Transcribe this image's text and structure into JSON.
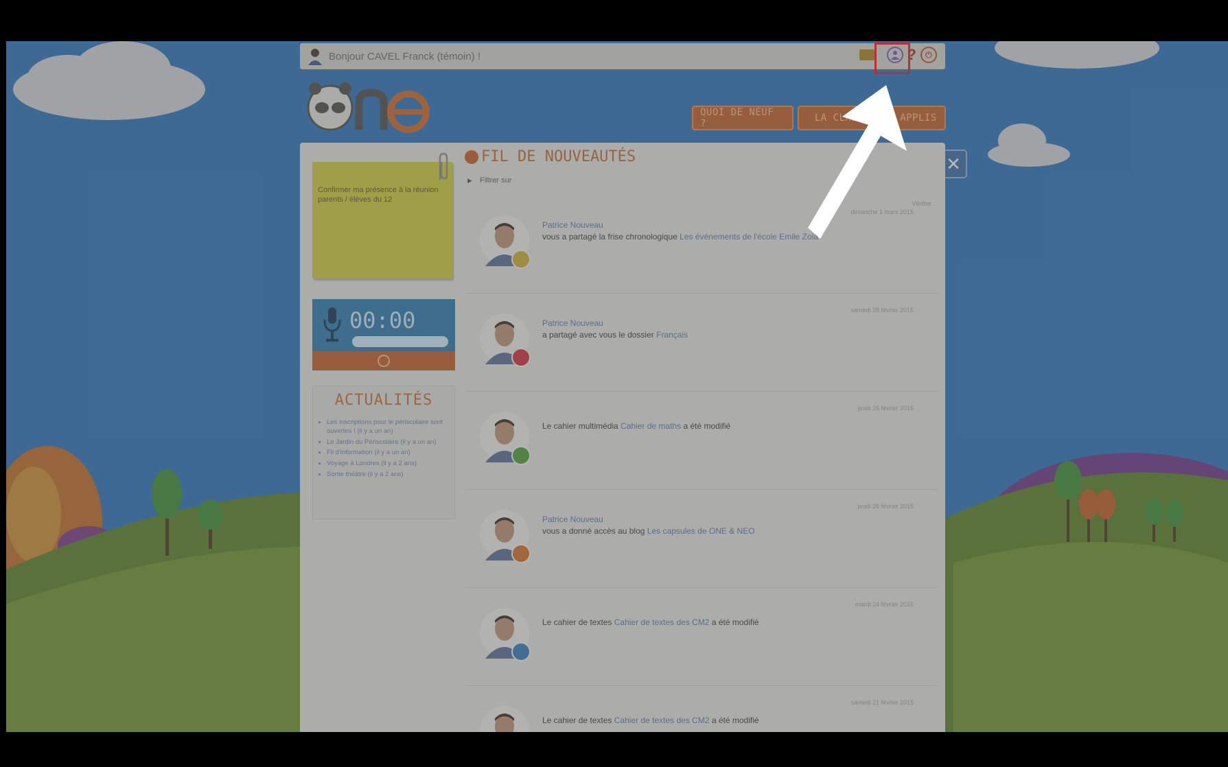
{
  "header": {
    "greeting": "Bonjour CAVEL Franck (témoin) !"
  },
  "nav": {
    "buttons": [
      "QUOI DE NEUF ?",
      "LA CLASSE",
      "APPLIS"
    ]
  },
  "postit": {
    "text": "Confirmer ma présence à la réunion parents / élèves du 12"
  },
  "recorder": {
    "time": "00:00"
  },
  "news": {
    "title": "ACTUALITÉS",
    "items": [
      "Les inscriptions pour le périscolaire sont ouvertes ! (il y a un an)",
      "Le Jardin du Périscolaire (il y a un an)",
      "Fil d'information (il y a un an)",
      "Voyage à Londres (il y a 2 ans)",
      "Sortie théâtre (il y a 2 ans)"
    ]
  },
  "feed": {
    "title": "FIL DE NOUVEAUTÉS",
    "filter": "Filtrer sur",
    "hint": "Vérifier",
    "items": [
      {
        "date": "dimanche 1 mars 2015",
        "who": "Patrice Nouveau",
        "pre": "vous a partagé la frise chronologique",
        "link": "Les événements de l'école Emile Zola",
        "post": "",
        "badge": "#c4a83a"
      },
      {
        "date": "samedi 28 février 2015",
        "who": "Patrice Nouveau",
        "pre": "a partagé avec vous le dossier",
        "link": "Français",
        "post": "",
        "badge": "#c4363f"
      },
      {
        "date": "jeudi 26 février 2015",
        "who": "",
        "pre": "Le cahier multimédia",
        "link": "Cahier de maths",
        "post": "a été modifié",
        "badge": "#4c9a3b"
      },
      {
        "date": "jeudi 26 février 2015",
        "who": "Patrice Nouveau",
        "pre": "vous a donné accès au blog",
        "link": "Les capsules de ONE & NEO",
        "post": "",
        "badge": "#c86d2c"
      },
      {
        "date": "mardi 24 février 2015",
        "who": "",
        "pre": "Le cahier de textes",
        "link": "Cahier de textes des CM2",
        "post": "a été modifié",
        "badge": "#3a78b5"
      },
      {
        "date": "samedi 21 février 2015",
        "who": "",
        "pre": "Le cahier de textes",
        "link": "Cahier de textes des CM2",
        "post": "a été modifié",
        "badge": "#3a78b5"
      }
    ]
  },
  "colors": {
    "highlight": "#e81c1c",
    "accent": "#b8602e"
  }
}
